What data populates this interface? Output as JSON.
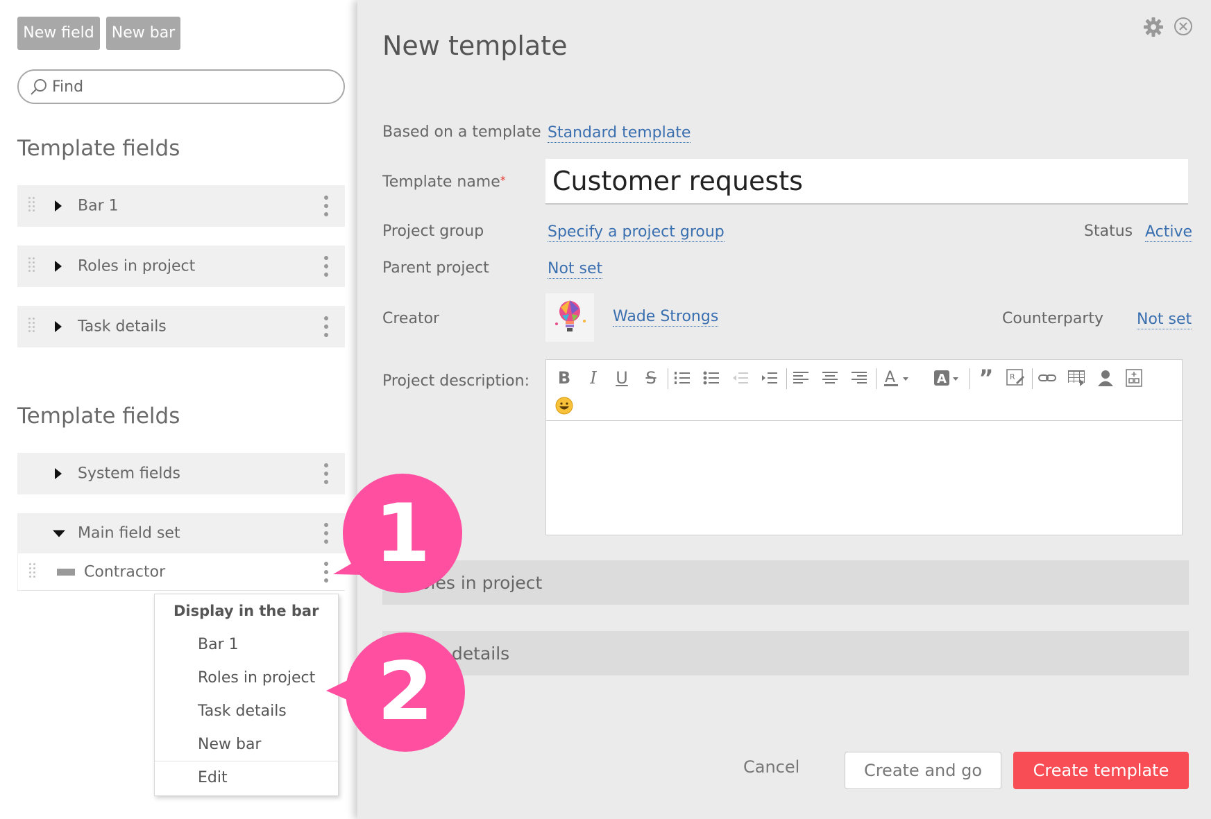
{
  "left_panel": {
    "new_field_label": "New field",
    "new_bar_label": "New bar",
    "search_placeholder": "Find",
    "section1_title": "Template fields",
    "section1_rows": [
      "Bar 1",
      "Roles in project",
      "Task details"
    ],
    "section2_title": "Template fields",
    "system_fields_label": "System fields",
    "main_field_set_label": "Main field set",
    "contractor_label": "Contractor"
  },
  "context_menu": {
    "header": "Display in the bar",
    "items": [
      "Bar 1",
      "Roles in project",
      "Task details",
      "New bar"
    ],
    "edit_label": "Edit"
  },
  "modal": {
    "title": "New template",
    "based_on_label": "Based on a template",
    "based_on_value": "Standard template",
    "template_name_label": "Template name",
    "required_mark": "*",
    "template_name_value": "Customer requests",
    "project_group_label": "Project group",
    "project_group_value": "Specify a project group",
    "status_label": "Status",
    "status_value": "Active",
    "parent_project_label": "Parent project",
    "parent_project_value": "Not set",
    "creator_label": "Creator",
    "creator_value": "Wade Strongs",
    "counterparty_label": "Counterparty",
    "counterparty_value": "Not set",
    "description_label": "Project description:",
    "toolbar_icons": [
      "bold-icon",
      "italic-icon",
      "underline-icon",
      "strikethrough-icon",
      "ordered-list-icon",
      "bullet-list-icon",
      "outdent-icon",
      "indent-icon",
      "align-left-icon",
      "align-center-icon",
      "align-right-icon",
      "text-color-icon",
      "background-color-icon",
      "quote-icon",
      "format-icon",
      "link-icon",
      "table-icon",
      "user-icon",
      "template-icon",
      "emoji-icon"
    ],
    "bar_roles_text": "Roles in project",
    "bar_task_text": "Task details",
    "cancel_label": "Cancel",
    "create_and_go_label": "Create and go",
    "create_template_label": "Create template"
  },
  "callouts": [
    {
      "number": "1"
    },
    {
      "number": "2"
    }
  ],
  "colors": {
    "accent_pink": "#ff4fa0",
    "create_button": "#f94d55",
    "link": "#3a6fb0",
    "gray_button": "#a8a8a8"
  }
}
